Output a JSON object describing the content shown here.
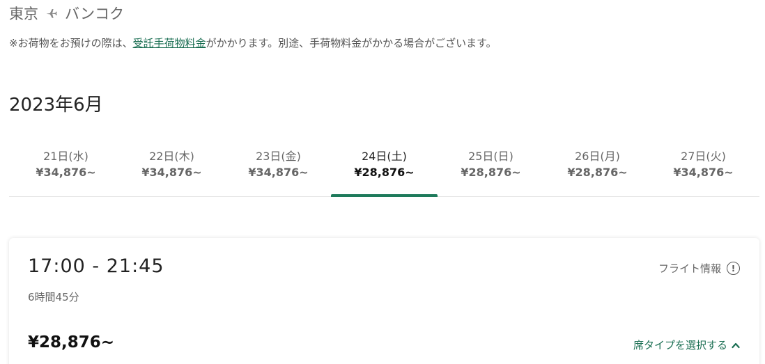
{
  "route": {
    "origin": "東京",
    "destination": "バンコク"
  },
  "notice": {
    "prefix": "※お荷物をお預けの際は、",
    "link": "受託手荷物料金",
    "suffix": "がかかります。別途、手荷物料金がかかる場合がございます。"
  },
  "month": "2023年6月",
  "date_tabs": [
    {
      "date": "21日(水)",
      "price": "¥34,876~"
    },
    {
      "date": "22日(木)",
      "price": "¥34,876~"
    },
    {
      "date": "23日(金)",
      "price": "¥34,876~"
    },
    {
      "date": "24日(土)",
      "price": "¥28,876~",
      "active": true
    },
    {
      "date": "25日(日)",
      "price": "¥28,876~"
    },
    {
      "date": "26日(月)",
      "price": "¥28,876~"
    },
    {
      "date": "27日(火)",
      "price": "¥34,876~"
    }
  ],
  "flight": {
    "time": "17:00 - 21:45",
    "duration": "6時間45分",
    "info_label": "フライト情報",
    "price": "¥28,876~",
    "seat_label": "席タイプを選択する"
  },
  "colors": {
    "accent": "#1e7a5b",
    "link": "#1a6e52"
  },
  "icons": {
    "route_separator": "plane-icon",
    "flight_info": "info-icon",
    "seat_toggle": "chevron-up-icon"
  }
}
